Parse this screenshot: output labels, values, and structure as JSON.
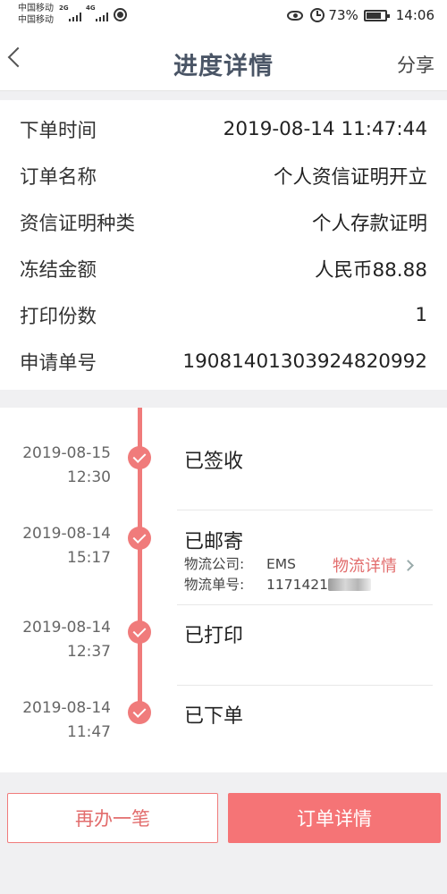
{
  "status_bar": {
    "carrier_1": "中国移动",
    "carrier_2": "中国移动",
    "network_1": "2G",
    "network_2": "4G",
    "battery": "73%",
    "battery_level": 0.73,
    "time": "14:06"
  },
  "nav": {
    "title": "进度详情",
    "share_label": "分享"
  },
  "info": {
    "rows": [
      {
        "label": "下单时间",
        "value": "2019-08-14 11:47:44"
      },
      {
        "label": "订单名称",
        "value": "个人资信证明开立"
      },
      {
        "label": "资信证明种类",
        "value": "个人存款证明"
      },
      {
        "label": "冻结金额",
        "value": "人民币88.88"
      },
      {
        "label": "打印份数",
        "value": "1"
      },
      {
        "label": "申请单号",
        "value": "19081401303924820992"
      }
    ]
  },
  "timeline": {
    "events": [
      {
        "date": "2019-08-15",
        "time": "12:30",
        "status": "已签收"
      },
      {
        "date": "2019-08-14",
        "time": "15:17",
        "status": "已邮寄"
      },
      {
        "date": "2019-08-14",
        "time": "12:37",
        "status": "已打印"
      },
      {
        "date": "2019-08-14",
        "time": "11:47",
        "status": "已下单"
      }
    ],
    "logistics": {
      "company_label": "物流公司:",
      "company": "EMS",
      "tracking_label": "物流单号:",
      "tracking": "1171421",
      "detail_link": "物流详情"
    }
  },
  "buttons": {
    "again": "再办一笔",
    "order_detail": "订单详情"
  },
  "colors": {
    "accent": "#f07b7b",
    "button_primary": "#f57476",
    "title": "#4a5566"
  }
}
